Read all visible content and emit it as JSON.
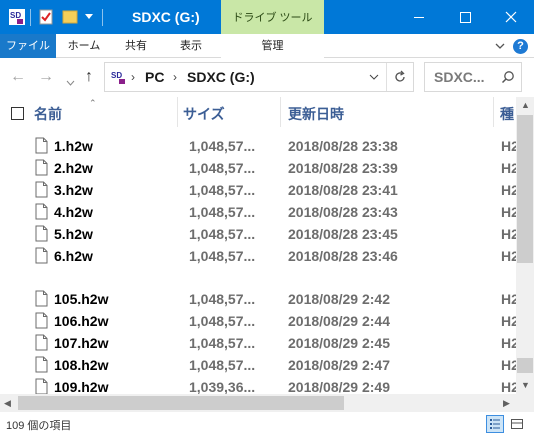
{
  "window": {
    "title": "SDXC (G:)",
    "context_tab": "ドライブ ツール",
    "accent": "#0078d7",
    "context_color": "#c9e7a7"
  },
  "ribbon": {
    "tabs": [
      {
        "label": "ファイル"
      },
      {
        "label": "ホーム"
      },
      {
        "label": "共有"
      },
      {
        "label": "表示"
      },
      {
        "label": "管理"
      }
    ]
  },
  "address": {
    "segments": [
      "PC",
      "SDXC (G:)"
    ],
    "search_placeholder": "SDXC..."
  },
  "columns": {
    "name": "名前",
    "size": "サイズ",
    "date": "更新日時",
    "type": "種"
  },
  "files": [
    {
      "name": "1.h2w",
      "size": "1,048,57...",
      "date": "2018/08/28 23:38",
      "type": "H2"
    },
    {
      "name": "2.h2w",
      "size": "1,048,57...",
      "date": "2018/08/28 23:39",
      "type": "H2"
    },
    {
      "name": "3.h2w",
      "size": "1,048,57...",
      "date": "2018/08/28 23:41",
      "type": "H2"
    },
    {
      "name": "4.h2w",
      "size": "1,048,57...",
      "date": "2018/08/28 23:43",
      "type": "H2"
    },
    {
      "name": "5.h2w",
      "size": "1,048,57...",
      "date": "2018/08/28 23:45",
      "type": "H2"
    },
    {
      "name": "6.h2w",
      "size": "1,048,57...",
      "date": "2018/08/28 23:46",
      "type": "H2"
    },
    {
      "name": "105.h2w",
      "size": "1,048,57...",
      "date": "2018/08/29 2:42",
      "type": "H2"
    },
    {
      "name": "106.h2w",
      "size": "1,048,57...",
      "date": "2018/08/29 2:44",
      "type": "H2"
    },
    {
      "name": "107.h2w",
      "size": "1,048,57...",
      "date": "2018/08/29 2:45",
      "type": "H2"
    },
    {
      "name": "108.h2w",
      "size": "1,048,57...",
      "date": "2018/08/29 2:47",
      "type": "H2"
    },
    {
      "name": "109.h2w",
      "size": "1,039,36...",
      "date": "2018/08/29 2:49",
      "type": "H2"
    }
  ],
  "status": {
    "item_count": "109 個の項目"
  }
}
